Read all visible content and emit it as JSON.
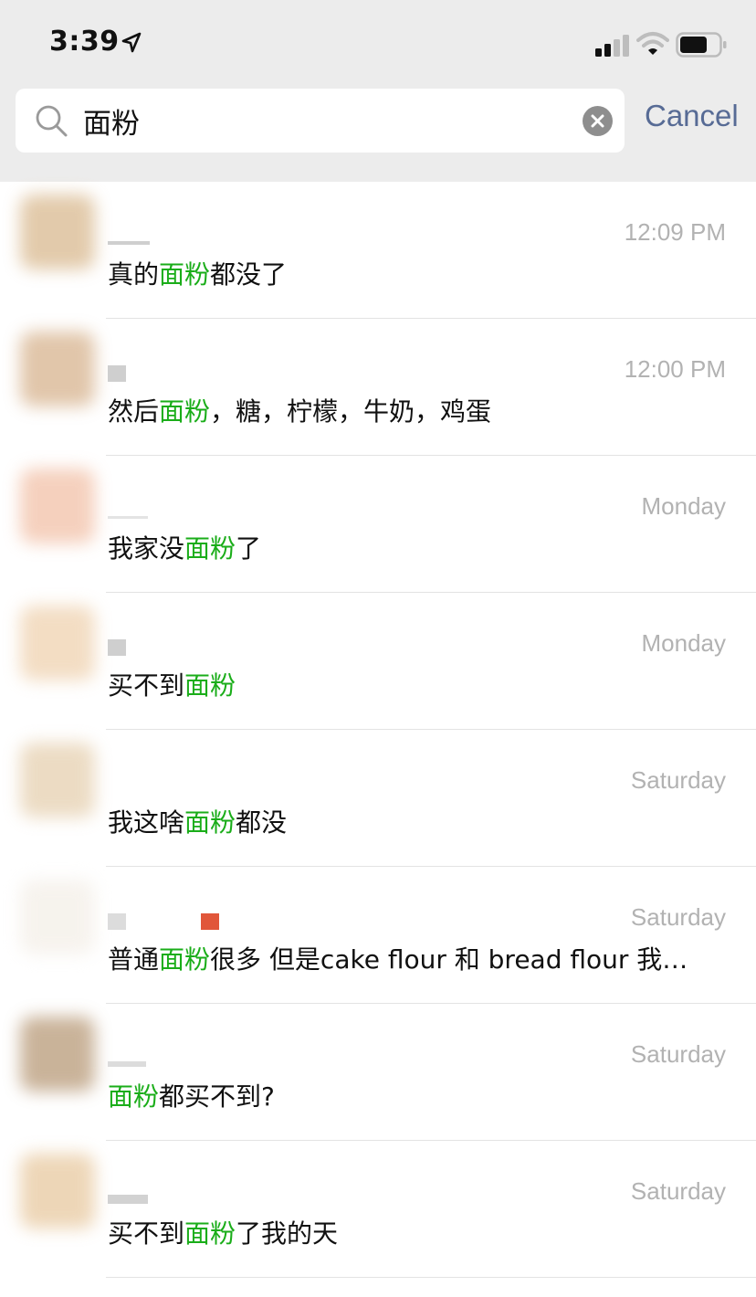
{
  "status_bar": {
    "time": "3:39"
  },
  "search": {
    "query": "面粉",
    "cancel_label": "Cancel"
  },
  "colors": {
    "highlight": "#1aad19",
    "cancel": "#576b95",
    "timestamp": "#b2b2b2"
  },
  "results": [
    {
      "time": "12:09 PM",
      "before": "真的",
      "match": "面粉",
      "after": "都没了"
    },
    {
      "time": "12:00 PM",
      "before": "然后",
      "match": "面粉",
      "after": "，糖，柠檬，牛奶，鸡蛋"
    },
    {
      "time": "Monday",
      "before": "我家没",
      "match": "面粉",
      "after": "了"
    },
    {
      "time": "Monday",
      "before": "买不到",
      "match": "面粉",
      "after": ""
    },
    {
      "time": "Saturday",
      "before": "我这啥",
      "match": "面粉",
      "after": "都没"
    },
    {
      "time": "Saturday",
      "before": "普通",
      "match": "面粉",
      "after": "很多 但是cake flour 和 bread flour 我…"
    },
    {
      "time": "Saturday",
      "before": "",
      "match": "面粉",
      "after": "都买不到?"
    },
    {
      "time": "Saturday",
      "before": "买不到",
      "match": "面粉",
      "after": "了我的天"
    }
  ]
}
